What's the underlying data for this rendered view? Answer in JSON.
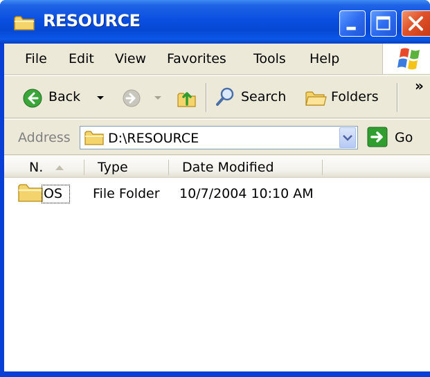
{
  "window": {
    "title": "RESOURCE",
    "icon": "folder-icon",
    "controls": {
      "minimize": "minimize-icon",
      "maximize": "maximize-icon",
      "close": "close-icon"
    }
  },
  "menu": {
    "items": [
      "File",
      "Edit",
      "View",
      "Favorites",
      "Tools",
      "Help"
    ],
    "logo": "windows-logo-icon"
  },
  "toolbar": {
    "back_label": "Back",
    "search_label": "Search",
    "folders_label": "Folders",
    "overflow": "»"
  },
  "address": {
    "label": "Address",
    "value": "D:\\RESOURCE",
    "go_label": "Go"
  },
  "list": {
    "columns": [
      "N.",
      "Type",
      "Date Modified"
    ],
    "rows": [
      {
        "name": "OS",
        "type": "File Folder",
        "modified": "10/7/2004 10:10 AM",
        "icon": "folder-icon"
      }
    ]
  },
  "colors": {
    "titlebar": "#0a4fe0",
    "chrome": "#ece9d8",
    "close_button": "#e0522a",
    "back_arrow": "#3aa63a",
    "go_arrow": "#2f9e2f",
    "folder": "#f3d36b"
  }
}
